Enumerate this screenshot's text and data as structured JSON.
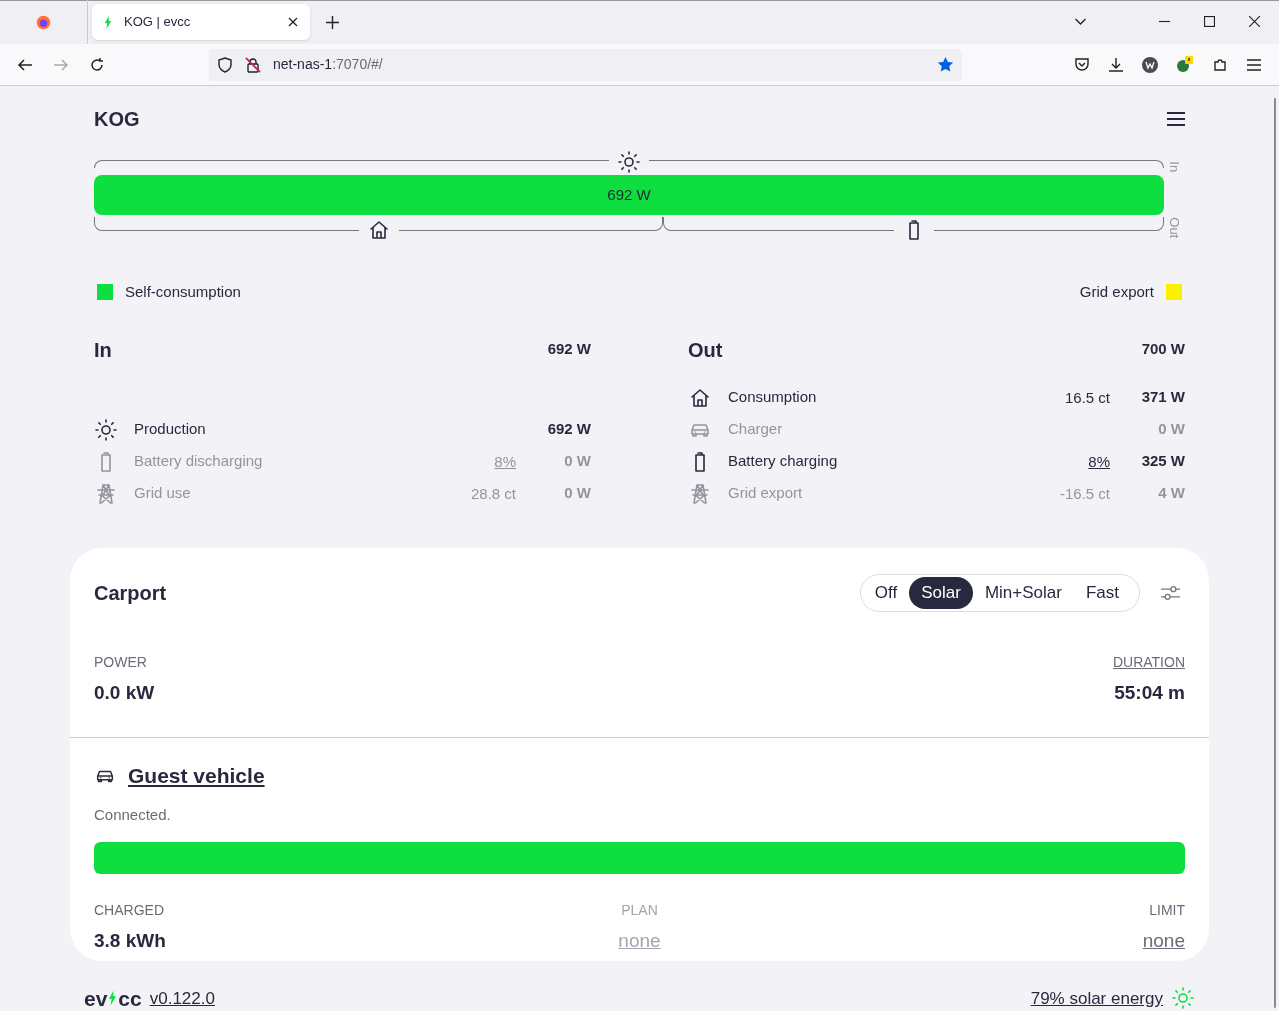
{
  "browser": {
    "tab_title": "KOG | evcc",
    "url_host": "net-nas-1",
    "url_rest": ":7070/#/",
    "bookmarked": true
  },
  "site": {
    "title": "KOG"
  },
  "energyflow": {
    "bar_label": "692 W",
    "in_label": "In",
    "out_label": "Out",
    "legend": [
      {
        "label": "Self-consumption",
        "color": "#0fde41"
      },
      {
        "label": "Grid export",
        "color": "#faf000"
      }
    ]
  },
  "in": {
    "title": "In",
    "total": "692 W",
    "rows": [
      {
        "kind": "sun",
        "label": "Production",
        "value": "692 W",
        "active": true
      },
      {
        "kind": "battery",
        "label": "Battery discharging",
        "percent": "8%",
        "value": "0 W",
        "active": false
      },
      {
        "kind": "pylon",
        "label": "Grid use",
        "price": "28.8 ct",
        "value": "0 W",
        "active": false
      }
    ]
  },
  "out": {
    "title": "Out",
    "total": "700 W",
    "rows": [
      {
        "kind": "house",
        "label": "Consumption",
        "price": "16.5 ct",
        "value": "371 W",
        "active": true
      },
      {
        "kind": "car",
        "label": "Charger",
        "value": "0 W",
        "active": false
      },
      {
        "kind": "battery",
        "label": "Battery charging",
        "percent": "8%",
        "value": "325 W",
        "active": true
      },
      {
        "kind": "pylon",
        "label": "Grid export",
        "price": "-16.5 ct",
        "value": "4 W",
        "active": false
      }
    ]
  },
  "loadpoint": {
    "title": "Carport",
    "modes": [
      {
        "label": "Off",
        "selected": false
      },
      {
        "label": "Solar",
        "selected": true
      },
      {
        "label": "Min+Solar",
        "selected": false
      },
      {
        "label": "Fast",
        "selected": false
      }
    ],
    "power_label": "POWER",
    "power": "0.0 kW",
    "duration_label": "DURATION",
    "duration": "55:04 m",
    "vehicle": "Guest vehicle",
    "status": "Connected.",
    "level": 1.0,
    "charged_label": "CHARGED",
    "charged": "3.8 kWh",
    "plan_label": "PLAN",
    "plan": "none",
    "limit_label": "LIMIT",
    "limit": "none"
  },
  "footer": {
    "logo": [
      "ev",
      "cc"
    ],
    "version": "v0.122.0",
    "solar": "79% solar energy"
  }
}
